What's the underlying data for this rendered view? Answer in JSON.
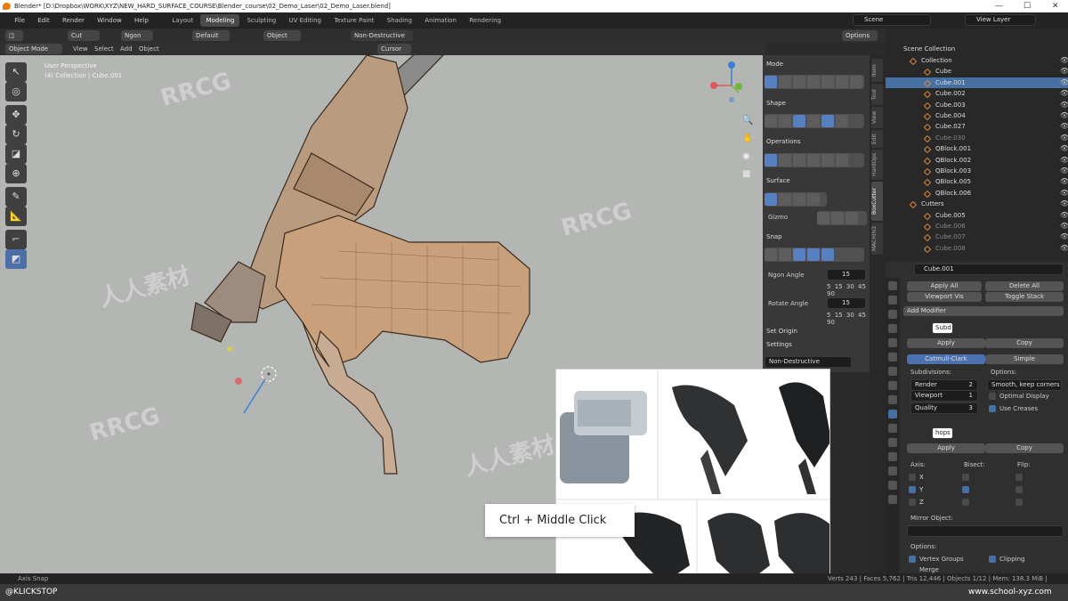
{
  "window": {
    "title": "Blender* [D:\\Dropbox\\WORK\\XYZ\\NEW_HARD_SURFACE_COURSE\\Blender_course\\02_Demo_Laser\\02_Demo_Laser.blend]"
  },
  "menu": [
    "File",
    "Edit",
    "Render",
    "Window",
    "Help"
  ],
  "workspaces": [
    {
      "label": "Layout",
      "active": false
    },
    {
      "label": "Modeling",
      "active": true
    },
    {
      "label": "Sculpting",
      "active": false
    },
    {
      "label": "UV Editing",
      "active": false
    },
    {
      "label": "Texture Paint",
      "active": false
    },
    {
      "label": "Shading",
      "active": false
    },
    {
      "label": "Animation",
      "active": false
    },
    {
      "label": "Rendering",
      "active": false
    }
  ],
  "scene": {
    "label": "Scene",
    "view_layer": "View Layer"
  },
  "tool_header": {
    "cut": "Cut",
    "ngon": "Ngon",
    "default": "Default",
    "object": "Object",
    "non_destructive": "Non-Destructive",
    "options": "Options",
    "cursor": "Cursor"
  },
  "viewport_header": {
    "mode": "Object Mode",
    "items": [
      "View",
      "Select",
      "Add",
      "Object"
    ]
  },
  "viewport": {
    "overlay_line1": "User Perspective",
    "overlay_line2": "(4) Collection | Cube.001"
  },
  "npanel": {
    "mode": "Mode",
    "shape": "Shape",
    "operations": "Operations",
    "surface": "Surface",
    "gizmo": "Gizmo",
    "snap": "Snap",
    "ngon_angle_label": "Ngon Angle",
    "ngon_angle_value": "15",
    "ngon_angle_presets": [
      "5",
      "15",
      "30",
      "45",
      "90"
    ],
    "rotate_angle_label": "Rotate Angle",
    "rotate_angle_value": "15",
    "rotate_angle_presets": [
      "5",
      "15",
      "30",
      "45",
      "90"
    ],
    "set_origin": "Set Origin",
    "settings": "Settings",
    "mode_dropdown": "Non-Destructive"
  },
  "side_tabs": [
    "Item",
    "Tool",
    "View",
    "Edit",
    "HardOps",
    "BoxCutter",
    "MACHIN3"
  ],
  "outliner": {
    "header": "Scene Collection",
    "rows": [
      {
        "label": "Collection",
        "indent": 1,
        "selected": false,
        "dim": false
      },
      {
        "label": "Cube",
        "indent": 2,
        "selected": false,
        "dim": false
      },
      {
        "label": "Cube.001",
        "indent": 2,
        "selected": true,
        "dim": false
      },
      {
        "label": "Cube.002",
        "indent": 2,
        "selected": false,
        "dim": false
      },
      {
        "label": "Cube.003",
        "indent": 2,
        "selected": false,
        "dim": false
      },
      {
        "label": "Cube.004",
        "indent": 2,
        "selected": false,
        "dim": false
      },
      {
        "label": "Cube.027",
        "indent": 2,
        "selected": false,
        "dim": false
      },
      {
        "label": "Cube.030",
        "indent": 2,
        "selected": false,
        "dim": true
      },
      {
        "label": "QBlock.001",
        "indent": 2,
        "selected": false,
        "dim": false
      },
      {
        "label": "QBlock.002",
        "indent": 2,
        "selected": false,
        "dim": false
      },
      {
        "label": "QBlock.003",
        "indent": 2,
        "selected": false,
        "dim": false
      },
      {
        "label": "QBlock.005",
        "indent": 2,
        "selected": false,
        "dim": false
      },
      {
        "label": "QBlock.006",
        "indent": 2,
        "selected": false,
        "dim": false
      },
      {
        "label": "Cutters",
        "indent": 1,
        "selected": false,
        "dim": false
      },
      {
        "label": "Cube.005",
        "indent": 2,
        "selected": false,
        "dim": false
      },
      {
        "label": "Cube.006",
        "indent": 2,
        "selected": false,
        "dim": true
      },
      {
        "label": "Cube.007",
        "indent": 2,
        "selected": false,
        "dim": true
      },
      {
        "label": "Cube.008",
        "indent": 2,
        "selected": false,
        "dim": true
      }
    ]
  },
  "properties": {
    "object_name": "Cube.001",
    "apply_all": "Apply All",
    "delete_all": "Delete All",
    "viewport_vis": "Viewport Vis",
    "toggle_stack": "Toggle Stack",
    "add_modifier": "Add Modifier",
    "subd": {
      "name": "Subd",
      "apply": "Apply",
      "copy": "Copy",
      "tab_catmull": "Catmull-Clark",
      "tab_simple": "Simple",
      "subdivisions": "Subdivisions:",
      "render_label": "Render",
      "render_value": "2",
      "viewport_label": "Viewport",
      "viewport_value": "1",
      "quality_label": "Quality",
      "quality_value": "3",
      "options": "Options:",
      "uv_smooth": "Smooth, keep corners",
      "optimal_display": "Optimal Display",
      "use_creases": "Use Creases"
    },
    "mirror": {
      "name": "hops",
      "apply": "Apply",
      "copy": "Copy",
      "axis": "Axis:",
      "bisect": "Bisect:",
      "flip": "Flip:",
      "x": "X",
      "y": "Y",
      "z": "Z",
      "mirror_object": "Mirror Object:",
      "options": "Options:",
      "vertex_groups": "Vertex Groups",
      "clipping": "Clipping",
      "merge": "Merge"
    }
  },
  "statusbar": {
    "left": "Axis Snap",
    "right": "Verts 243 | Faces 5,762 | Tris 12,446 | Objects 1/12 | Mem: 138.3 MiB | v2.81.7"
  },
  "footer": {
    "left": "@KLICKSTOP",
    "right": "www.school-xyz.com"
  },
  "overlay": {
    "caption": "Ctrl + Middle Click",
    "watermarks": [
      "RRCG",
      "人人素材"
    ]
  },
  "colors": {
    "accent_blue": "#4670a1",
    "model_tan": "#c9a07c",
    "active_tool": "#4d6fa8"
  }
}
